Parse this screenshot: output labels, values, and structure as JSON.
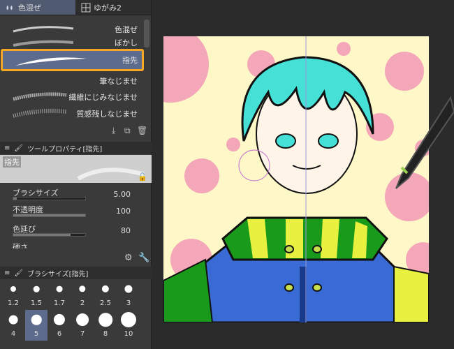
{
  "tabs": [
    {
      "label": "色混ぜ"
    },
    {
      "label": "ゆがみ2"
    }
  ],
  "brushes": [
    {
      "label": "色混ぜ"
    },
    {
      "label": "ぼかし"
    },
    {
      "label": "指先"
    },
    {
      "label": "筆なじませ"
    },
    {
      "label": "繊維にじみなじませ"
    },
    {
      "label": "質感残しなじませ"
    }
  ],
  "tool_property": {
    "title": "ツールプロパティ[指先]",
    "tool_name": "指先",
    "props": [
      {
        "label": "ブラシサイズ",
        "value": "5.00",
        "level": 0.05
      },
      {
        "label": "不透明度",
        "value": "100",
        "level": 1.0
      },
      {
        "label": "色延び",
        "value": "80",
        "level": 0.8
      },
      {
        "label": "硬さ",
        "value": ""
      }
    ]
  },
  "brush_size": {
    "title": "ブラシサイズ[指先]",
    "sizes": [
      "1.2",
      "1.5",
      "1.7",
      "2",
      "2.5",
      "3",
      "4",
      "5",
      "6",
      "7",
      "8",
      "10"
    ],
    "selected": "5"
  },
  "colors": {
    "accent": "#f5a623",
    "selected_bg": "#5d6b8c",
    "pink": "#f4a7b9",
    "hair": "#45e0d6",
    "scarf_green": "#1a9a1a",
    "scarf_yellow": "#e8f040",
    "coat": "#3a6bd4"
  }
}
